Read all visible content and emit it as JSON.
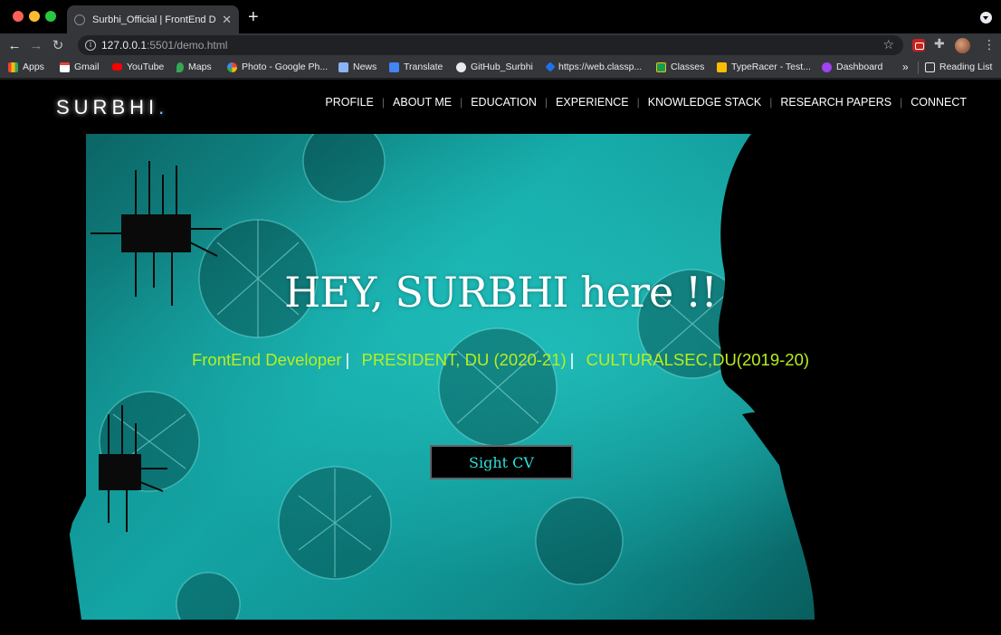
{
  "browser": {
    "tab": {
      "title": "Surbhi_Official | FrontEnd Developer",
      "close_icon": "close-icon"
    },
    "newtab_label": "+",
    "url": {
      "host": "127.0.0.1",
      "rest": ":5501/demo.html"
    },
    "bookmarks": [
      {
        "label": "Apps",
        "icon": "apps-grid-icon",
        "color": "#ea4335"
      },
      {
        "label": "Gmail",
        "icon": "gmail-icon",
        "color": "#ea4335"
      },
      {
        "label": "YouTube",
        "icon": "youtube-icon",
        "color": "#ff0000"
      },
      {
        "label": "Maps",
        "icon": "maps-icon",
        "color": "#34a853"
      },
      {
        "label": "Photo - Google Ph...",
        "icon": "google-photos-icon",
        "color": "#fbbc04"
      },
      {
        "label": "News",
        "icon": "news-icon",
        "color": "#8ab4f8"
      },
      {
        "label": "Translate",
        "icon": "translate-icon",
        "color": "#4285f4"
      },
      {
        "label": "GitHub_Surbhi",
        "icon": "github-icon",
        "color": "#e8eaed"
      },
      {
        "label": "https://web.classp...",
        "icon": "classplus-icon",
        "color": "#1a73e8"
      },
      {
        "label": "Classes",
        "icon": "classroom-icon",
        "color": "#0f9d58"
      },
      {
        "label": "TypeRacer - Test...",
        "icon": "typeracer-icon",
        "color": "#fbbc04"
      },
      {
        "label": "Dashboard",
        "icon": "dashboard-icon",
        "color": "#a142f4"
      }
    ],
    "bookmarks_more": "»",
    "reading_list": "Reading List"
  },
  "site": {
    "logo": "SURBHI",
    "logo_dot": ".",
    "nav": [
      "PROFILE",
      "ABOUT ME",
      "EDUCATION",
      "EXPERIENCE",
      "KNOWLEDGE STACK",
      "RESEARCH PAPERS",
      "CONNECT"
    ],
    "nav_separator": "|",
    "hero": {
      "title": "HEY, SURBHI here !!",
      "roles": [
        "FrontEnd Developer",
        "PRESIDENT, DU (2020-21)",
        "CULTURALSEC,DU(2019-20)"
      ],
      "role_separator": "|",
      "cv_button": "Sight CV"
    }
  },
  "colors": {
    "accent_role": "#b9ef1c",
    "accent_button_text": "#2de0d6",
    "hero_teal": "#13a7a6"
  }
}
